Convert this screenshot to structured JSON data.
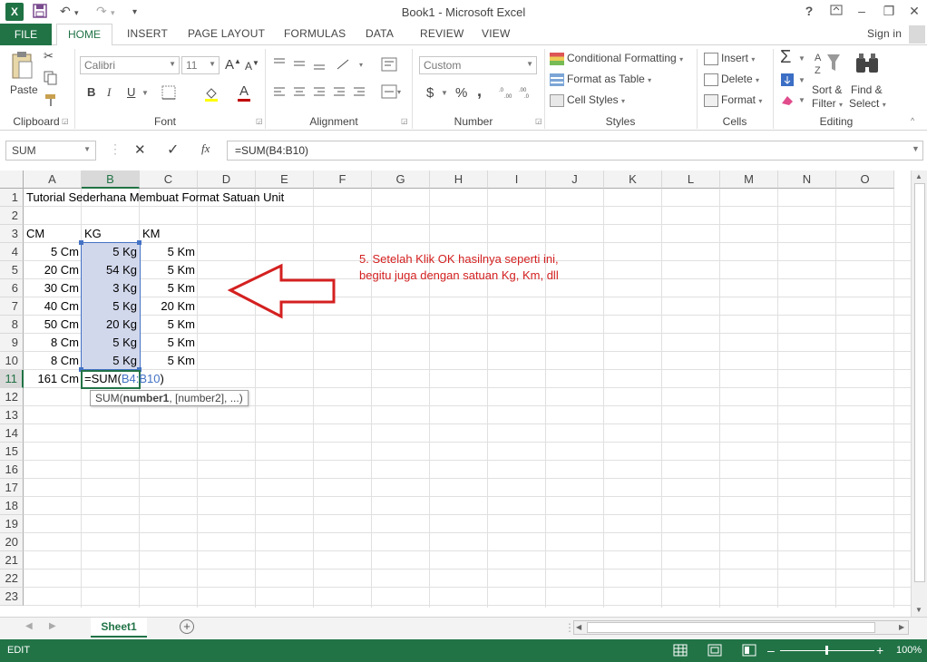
{
  "window": {
    "title": "Book1 - Microsoft Excel",
    "help": "?",
    "minimize": "–",
    "restore": "❐",
    "close": "✕"
  },
  "qat": {
    "save_icon": "save-icon",
    "undo_icon": "undo-icon",
    "redo_icon": "redo-icon"
  },
  "tabs": [
    {
      "label": "FILE"
    },
    {
      "label": "HOME"
    },
    {
      "label": "INSERT"
    },
    {
      "label": "PAGE LAYOUT"
    },
    {
      "label": "FORMULAS"
    },
    {
      "label": "DATA"
    },
    {
      "label": "REVIEW"
    },
    {
      "label": "VIEW"
    }
  ],
  "sign_in": "Sign in",
  "ribbon": {
    "clipboard": {
      "paste": "Paste",
      "label": "Clipboard"
    },
    "font": {
      "name": "Calibri",
      "size": "11",
      "bold": "B",
      "italic": "I",
      "underline": "U",
      "label": "Font",
      "grow": "A",
      "shrink": "A",
      "color": "A"
    },
    "alignment": {
      "label": "Alignment"
    },
    "number": {
      "format": "Custom",
      "currency": "$",
      "percent": "%",
      "comma": ",",
      "label": "Number"
    },
    "styles": {
      "conditional": "Conditional Formatting",
      "table": "Format as Table",
      "cell_styles": "Cell Styles",
      "label": "Styles"
    },
    "cells": {
      "insert": "Insert",
      "delete": "Delete",
      "format": "Format",
      "label": "Cells"
    },
    "editing": {
      "sort1": "Sort &",
      "sort2": "Filter",
      "find1": "Find &",
      "find2": "Select",
      "label": "Editing"
    }
  },
  "formula_bar": {
    "name_box": "SUM",
    "cancel": "✕",
    "enter": "✓",
    "fx": "fx",
    "formula": "=SUM(B4:B10)"
  },
  "columns": [
    "A",
    "B",
    "C",
    "D",
    "E",
    "F",
    "G",
    "H",
    "I",
    "J",
    "K",
    "L",
    "M",
    "N",
    "O"
  ],
  "rows": [
    "1",
    "2",
    "3",
    "4",
    "5",
    "6",
    "7",
    "8",
    "9",
    "10",
    "11",
    "12",
    "13",
    "14",
    "15",
    "16",
    "17",
    "18",
    "19",
    "20",
    "21",
    "22",
    "23"
  ],
  "cells": {
    "a1": "Tutorial Sederhana Membuat Format Satuan Unit",
    "a3": "CM",
    "b3": "KG",
    "c3": "KM",
    "data": [
      {
        "a": "5 Cm",
        "b": "5 Kg",
        "c": "5 Km"
      },
      {
        "a": "20 Cm",
        "b": "54 Kg",
        "c": "5 Km"
      },
      {
        "a": "30 Cm",
        "b": "3 Kg",
        "c": "5 Km"
      },
      {
        "a": "40 Cm",
        "b": "5 Kg",
        "c": "20 Km"
      },
      {
        "a": "50 Cm",
        "b": "20 Kg",
        "c": "5 Km"
      },
      {
        "a": "8 Cm",
        "b": "5 Kg",
        "c": "5 Km"
      },
      {
        "a": "8 Cm",
        "b": "5 Kg",
        "c": "5 Km"
      }
    ],
    "a11": "161 Cm",
    "b11_prefix": "=SUM(",
    "b11_ref": "B4:B10",
    "b11_suffix": ")"
  },
  "tooltip": {
    "fn": "SUM(",
    "arg1": "number1",
    "rest": ", [number2], ...)"
  },
  "annotation": {
    "line1": "5. Setelah Klik OK hasilnya seperti ini,",
    "line2": "begitu juga dengan satuan Kg, Km, dll",
    "color": "#d42020"
  },
  "sheet_tab": "Sheet1",
  "status": {
    "mode": "EDIT",
    "zoom": "100%"
  },
  "colors": {
    "accent": "#217346",
    "selection": "#d2d8ec",
    "ref_blue": "#4472c4"
  }
}
